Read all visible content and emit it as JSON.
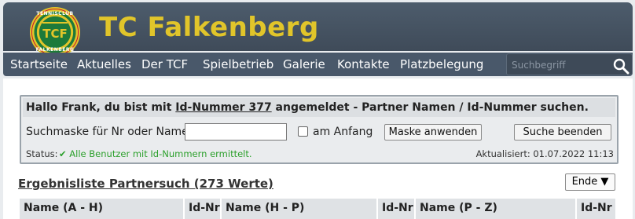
{
  "header": {
    "title": "TC Falkenberg",
    "logo": {
      "ring_top": "TENNISCLUB",
      "ring_bottom": "FALKENBERG",
      "center": "TCF"
    }
  },
  "nav": {
    "items": [
      "Startseite",
      "Aktuelles",
      "Der TCF",
      "Spielbetrieb",
      "Galerie",
      "Kontakte",
      "Platzbelegung"
    ],
    "search_placeholder": "Suchbegriff"
  },
  "panel": {
    "greeting_prefix": "Hallo Frank, du bist mit ",
    "id_link": "Id-Nummer 377",
    "greeting_suffix": " angemeldet - Partner Namen / Id-Nummer suchen.",
    "search_label": "Suchmaske für Nr oder Name:",
    "search_value": "",
    "checkbox_label": "am Anfang",
    "apply_button": "Maske anwenden",
    "end_button": "Suche beenden",
    "status_label": "Status:",
    "status_text": "✔ Alle Benutzer mit Id-Nummern ermittelt.",
    "updated": "Aktualisiert: 01.07.2022 11:13"
  },
  "results": {
    "title": "Ergebnisliste Partnersuch (273 Werte)",
    "end_button": "Ende ▼",
    "columns": [
      "Name  (A - H)",
      "Id-Nr",
      "Name  (H - P)",
      "Id-Nr",
      "Name  (P - Z)",
      "Id-Nr"
    ]
  },
  "colors": {
    "brand_gold": "#e1c52a",
    "header_bg": "#4d5c6c",
    "status_ok": "#2ca02c"
  }
}
